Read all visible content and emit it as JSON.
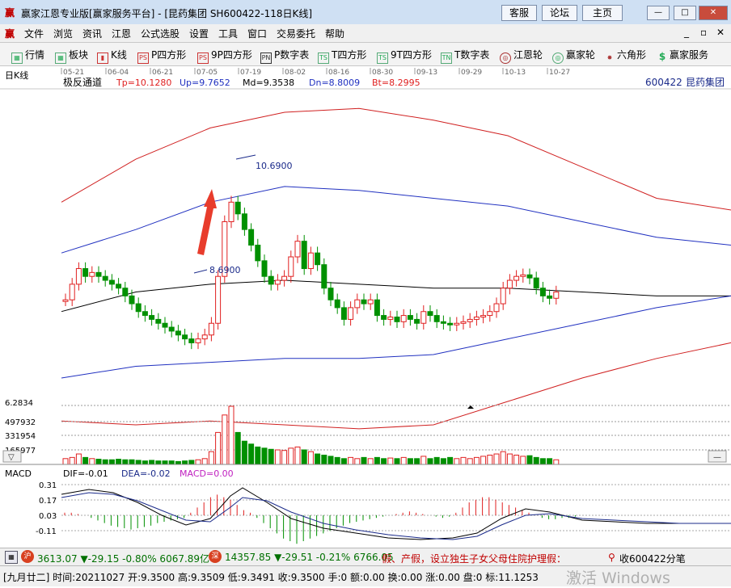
{
  "window": {
    "logo": "赢",
    "title": "赢家江恩专业版[赢家服务平台] - [昆药集团  SH600422-118日K线]",
    "buttons": [
      "客服",
      "论坛",
      "主页"
    ],
    "controls": [
      "—",
      "□",
      "✕"
    ]
  },
  "menu": {
    "logo": "赢",
    "items": [
      "文件",
      "浏览",
      "资讯",
      "江恩",
      "公式选股",
      "设置",
      "工具",
      "窗口",
      "交易委托",
      "帮助"
    ],
    "mdi_controls": [
      "_",
      "▫",
      "✕"
    ]
  },
  "toolbar": {
    "items": [
      {
        "label": "行情",
        "icon": "grid-icon"
      },
      {
        "label": "板块",
        "icon": "blocks-icon"
      },
      {
        "label": "K线",
        "icon": "candles-icon"
      },
      {
        "label": "P四方形",
        "icon": "ps-icon"
      },
      {
        "label": "9P四方形",
        "icon": "9ps-icon"
      },
      {
        "label": "P数字表",
        "icon": "pn-icon"
      },
      {
        "label": "T四方形",
        "icon": "ts-icon"
      },
      {
        "label": "9T四方形",
        "icon": "9ts-icon"
      },
      {
        "label": "T数字表",
        "icon": "tn-icon"
      },
      {
        "label": "江恩轮",
        "icon": "wheel-icon"
      },
      {
        "label": "赢家轮",
        "icon": "wheel2-icon"
      },
      {
        "label": "六角形",
        "icon": "hexagon-icon"
      },
      {
        "label": "赢家服务",
        "icon": "dollar-icon"
      }
    ],
    "icon_glyphs": [
      "▦",
      "▦",
      "▮",
      "PS",
      "PS",
      "PN",
      "TS",
      "TS",
      "TN",
      "◎",
      "◎",
      "✸",
      "$"
    ]
  },
  "chart": {
    "period": "日K线",
    "indicator_name": "极反通道",
    "params": [
      {
        "label": "Tp=10.1280",
        "color": "#e02020"
      },
      {
        "label": "Up=9.7652",
        "color": "#2030c0"
      },
      {
        "label": "Md=9.3538",
        "color": "#000000"
      },
      {
        "label": "Dn=8.8009",
        "color": "#2030c0"
      },
      {
        "label": "Bt=8.2995",
        "color": "#e02020"
      }
    ],
    "dates": [
      "05-21",
      "06-04",
      "06-21",
      "07-05",
      "07-19",
      "08-02",
      "08-16",
      "08-30",
      "09-13",
      "09-29",
      "10-13",
      "10-27"
    ],
    "code": "600422",
    "name": "昆药集团",
    "high_label": "10.6900",
    "low_label": "8.6900",
    "volume_ticks": [
      "6.2834",
      "497932",
      "331954",
      "165977"
    ],
    "macd": {
      "name": "MACD",
      "dif": "DIF=-0.01",
      "dea": "DEA=-0.02",
      "macd": "MACD=0.00",
      "ticks": [
        "0.31",
        "0.17",
        "0.03",
        "-0.11"
      ]
    },
    "colors": {
      "up": "#e02020",
      "down": "#009000",
      "md": "#000000",
      "band_inner": "#2030c0",
      "band_outer": "#d02020"
    }
  },
  "chart_data": {
    "type": "candlestick",
    "title": "昆药集团 SH600422 日K线",
    "x": [
      "05-21",
      "06-04",
      "06-21",
      "07-05",
      "07-19",
      "08-02",
      "08-16",
      "08-30",
      "09-13",
      "09-29",
      "10-13",
      "10-27"
    ],
    "ylim": [
      8.0,
      12.0
    ],
    "high": 10.69,
    "low": 8.69,
    "series": [
      {
        "name": "Tp",
        "values": [
          10.55,
          11.1,
          11.5,
          11.7,
          11.75,
          11.6,
          11.4,
          11.0,
          10.6,
          10.45
        ]
      },
      {
        "name": "Up",
        "values": [
          9.9,
          10.2,
          10.55,
          10.75,
          10.7,
          10.6,
          10.5,
          10.3,
          10.1,
          10.0
        ]
      },
      {
        "name": "Md",
        "values": [
          9.15,
          9.4,
          9.5,
          9.55,
          9.5,
          9.45,
          9.45,
          9.4,
          9.35,
          9.35
        ]
      },
      {
        "name": "Dn",
        "values": [
          8.3,
          8.45,
          8.5,
          8.55,
          8.55,
          8.6,
          8.8,
          9.0,
          9.2,
          9.35
        ]
      },
      {
        "name": "Bt",
        "values": [
          7.75,
          7.7,
          7.75,
          7.7,
          7.65,
          7.7,
          8.0,
          8.3,
          8.55,
          8.75
        ]
      }
    ]
  },
  "status": {
    "sh_index": "3613.07 ▼-29.15 -0.80% 6067.89亿",
    "sz_index": "14357.85 ▼-29.51 -0.21% 6766.05",
    "ticker_text": "假、产假，设立独生子女父母住院护理假：",
    "collect_text": "收600422分笔"
  },
  "info": {
    "text": "[九月廿二] 时间:20211027 开:9.3500 高:9.3509 低:9.3491 收:9.3500 手:0 额:0.00 换:0.00 涨:0.00 盘:0 标:11.1253",
    "watermark": "激活 Windows"
  }
}
